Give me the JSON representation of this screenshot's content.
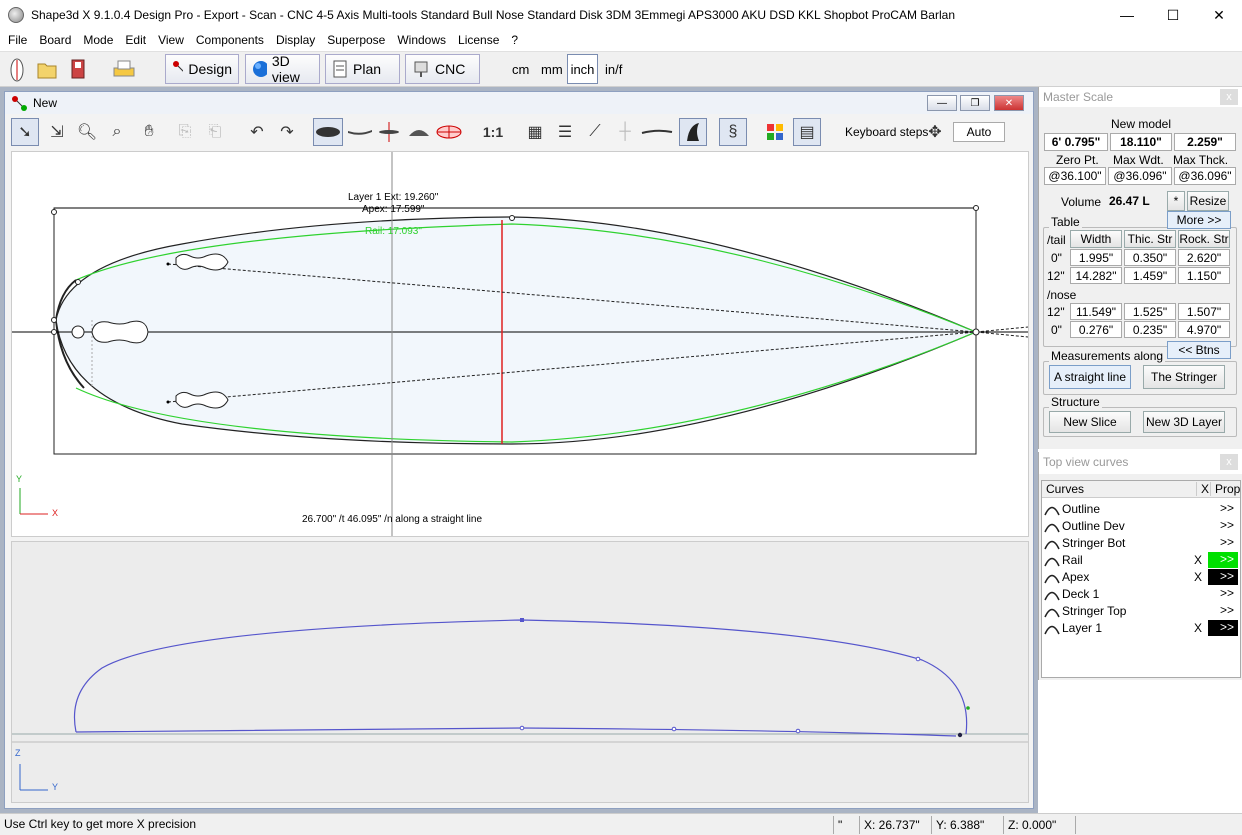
{
  "window": {
    "title": "Shape3d X 9.1.0.4 Design Pro - Export - Scan - CNC 4-5 Axis Multi-tools  Standard Bull Nose Standard Disk 3DM 3Emmegi APS3000 AKU DSD KKL Shopbot ProCAM Barlan",
    "minimize": "—",
    "maximize": "☐",
    "close": "✕"
  },
  "menu": [
    "File",
    "Board",
    "Mode",
    "Edit",
    "View",
    "Components",
    "Display",
    "Superpose",
    "Windows",
    "License",
    "?"
  ],
  "modes": {
    "design": "Design",
    "view3d": "3D view",
    "plan": "Plan",
    "cnc": "CNC"
  },
  "units": {
    "cm": "cm",
    "mm": "mm",
    "inch": "inch",
    "inf": "in/f"
  },
  "child": {
    "title": "New",
    "ratio": "1:1",
    "keyboard_steps": "Keyboard steps",
    "auto": "Auto"
  },
  "topview": {
    "layer_ext": "Layer 1 Ext: 19.260\"",
    "apex": "Apex: 17.599\"",
    "rail": "Rail: 17.093\"",
    "readout": "26.700\" /t 46.095\" /n along a straight line",
    "axis_y": "Y",
    "axis_x": "X"
  },
  "sideview": {
    "axis_z": "Z",
    "axis_y": "Y"
  },
  "master": {
    "title": "Master Scale",
    "close": "x",
    "model": "New model",
    "length": "6' 0.795\"",
    "width": "18.110\"",
    "thickness": "2.259\"",
    "zero_pt_label": "Zero Pt.",
    "max_wdt_label": "Max Wdt.",
    "max_thck_label": "Max Thck.",
    "zero_pt": "@36.100\"",
    "max_wdt": "@36.096\"",
    "max_thck": "@36.096\"",
    "volume_label": "Volume",
    "volume": "26.47 L",
    "star": "*",
    "resize": "Resize",
    "table_label": "Table",
    "more": "More >>",
    "col_tail": "/tail",
    "col_width": "Width",
    "col_thic": "Thic. Str",
    "col_rock": "Rock. Str",
    "nose_label": "/nose",
    "rows_tail": [
      [
        "0\"",
        "1.995\"",
        "0.350\"",
        "2.620\""
      ],
      [
        "12\"",
        "14.282\"",
        "1.459\"",
        "1.150\""
      ]
    ],
    "rows_nose": [
      [
        "12\"",
        "11.549\"",
        "1.525\"",
        "1.507\""
      ],
      [
        "0\"",
        "0.276\"",
        "0.235\"",
        "4.970\""
      ]
    ],
    "btns": "<< Btns",
    "meas_label": "Measurements along",
    "straight": "A straight line",
    "stringer": "The Stringer",
    "struct_label": "Structure",
    "new_slice": "New Slice",
    "new_layer": "New 3D Layer"
  },
  "curves": {
    "title": "Top view curves",
    "close": "x",
    "h_curves": "Curves",
    "h_x": "X",
    "h_prop": "Prop",
    "items": [
      {
        "name": "Outline",
        "x": "",
        "prop": ">>",
        "color": ""
      },
      {
        "name": "Outline Dev",
        "x": "",
        "prop": ">>",
        "color": ""
      },
      {
        "name": "Stringer Bot",
        "x": "",
        "prop": ">>",
        "color": ""
      },
      {
        "name": "Rail",
        "x": "X",
        "prop": ">>",
        "color": "#00e000"
      },
      {
        "name": "Apex",
        "x": "X",
        "prop": ">>",
        "color": "#000000"
      },
      {
        "name": "Deck 1",
        "x": "",
        "prop": ">>",
        "color": ""
      },
      {
        "name": "Stringer Top",
        "x": "",
        "prop": ">>",
        "color": ""
      },
      {
        "name": "Layer 1",
        "x": "X",
        "prop": ">>",
        "color": "#000000"
      }
    ]
  },
  "status": {
    "hint": "Use Ctrl key to get more X precision",
    "unit": "\"",
    "x": "X: 26.737\"",
    "y": "Y: 6.388\"",
    "z": "Z: 0.000\""
  }
}
